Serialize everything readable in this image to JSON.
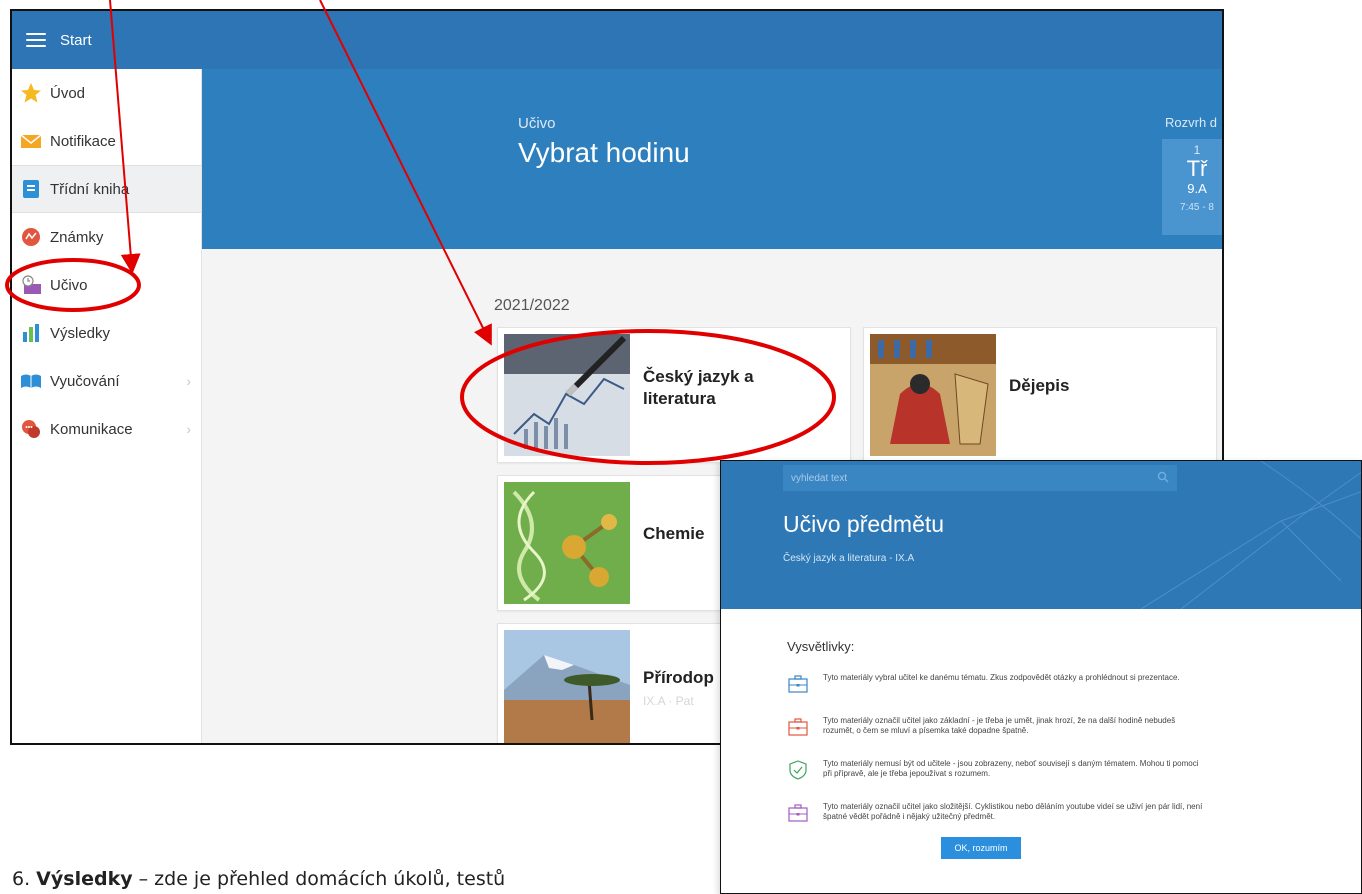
{
  "topbar": {
    "title": "Start"
  },
  "sidebar": {
    "items": [
      {
        "label": "Úvod"
      },
      {
        "label": "Notifikace"
      },
      {
        "label": "Třídní kniha"
      },
      {
        "label": "Známky"
      },
      {
        "label": "Učivo"
      },
      {
        "label": "Výsledky"
      },
      {
        "label": "Vyučování"
      },
      {
        "label": "Komunikace"
      }
    ]
  },
  "hero": {
    "section": "Učivo",
    "title": "Vybrat hodinu",
    "rozvrh_label": "Rozvrh d",
    "rozvrh_num": "1",
    "rozvrh_big": "Tř",
    "rozvrh_class": "9.A",
    "rozvrh_time": "7:45 - 8"
  },
  "year": "2021/2022",
  "cards": [
    {
      "title": "Český jazyk a literatura",
      "sub": ""
    },
    {
      "title": "Dějepis",
      "sub": ""
    },
    {
      "title": "Chemie",
      "sub": ""
    },
    {
      "title": "Přírodop",
      "sub": "IX.A · Pat"
    }
  ],
  "detail": {
    "search_placeholder": "vyhledat text",
    "title": "Učivo předmětu",
    "subtitle": "Český jazyk a literatura - IX.A",
    "legend_label": "Vysvětlivky:",
    "legend": [
      {
        "text": "Tyto materiály vybral učitel ke danému tématu. Zkus zodpovědět otázky a prohlédnout si prezentace.",
        "color": "#3b86c6",
        "icon": "briefcase-icon"
      },
      {
        "text": "Tyto materiály označil učitel jako základní - je třeba je umět, jinak hrozí, že na další hodině nebudeš rozumět, o čem se mluví a písemka také dopadne špatně.",
        "color": "#e2553f",
        "icon": "briefcase-icon"
      },
      {
        "text": "Tyto materiály nemusí být od učitele - jsou zobrazeny, neboť souvisejí s daným tématem. Mohou ti pomoci při přípravě, ale je třeba jepoužívat s rozumem.",
        "color": "#3aa55a",
        "icon": "shield-check-icon"
      },
      {
        "text": "Tyto materiály označil učitel jako složitější. Cyklistikou nebo děláním youtube videí se uživí jen pár lidí, není špatné vědět pořádně i nějaký užitečný předmět.",
        "color": "#a25bc4",
        "icon": "briefcase-icon"
      }
    ],
    "ok_label": "OK, rozumím"
  },
  "doc": {
    "bold": "Výsledky",
    "rest": " – zde je přehled domácích úkolů, testů",
    "prefix": "6. "
  },
  "colors": {
    "topbar": "#2d75b4",
    "hero": "#2e7fbe",
    "annotation": "#e00000"
  }
}
